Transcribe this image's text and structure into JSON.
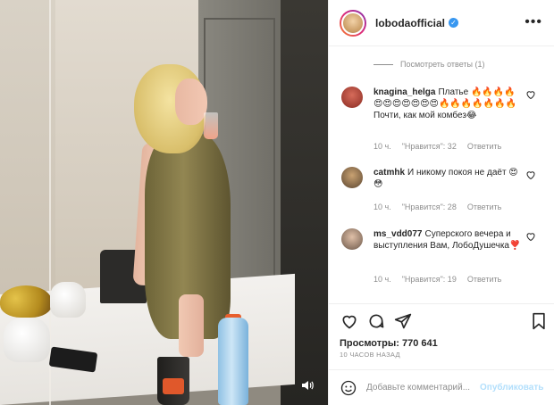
{
  "post": {
    "username": "lobodaofficial",
    "more_label": "•••",
    "view_replies": "Посмотреть ответы (1)",
    "views_label": "Просмотры: 770 641",
    "time_ago": "10 ЧАСОВ НАЗАД",
    "comment_placeholder": "Добавьте комментарий...",
    "publish_label": "Опубликовать"
  },
  "comments": [
    {
      "username": "knagina_helga",
      "text": "Платье 🔥🔥🔥🔥😍😍😍😍😍😍😍🔥🔥🔥🔥🔥🔥🔥Почти, как мой комбез😂",
      "time": "10 ч.",
      "likes": "\"Нравится\": 32",
      "reply": "Ответить"
    },
    {
      "username": "catmhk",
      "text": "И никому покоя не даёт 😍😳",
      "time": "10 ч.",
      "likes": "\"Нравится\": 28",
      "reply": "Ответить"
    },
    {
      "username": "ms_vdd077",
      "text": "Суперского вечера и выступления Вам, ЛобоДушечка❣️",
      "time": "10 ч.",
      "likes": "\"Нравится\": 19",
      "reply": "Ответить"
    }
  ],
  "icons": {
    "heart": "heart-icon",
    "comment": "comment-icon",
    "share": "share-icon",
    "bookmark": "bookmark-icon",
    "emoji": "smiley-icon",
    "volume": "volume-icon",
    "verified": "verified-badge-icon"
  },
  "colors": {
    "link_blue": "#3897f0",
    "publish_disabled": "#b2dffc",
    "secondary_text": "#8e8e8e"
  }
}
